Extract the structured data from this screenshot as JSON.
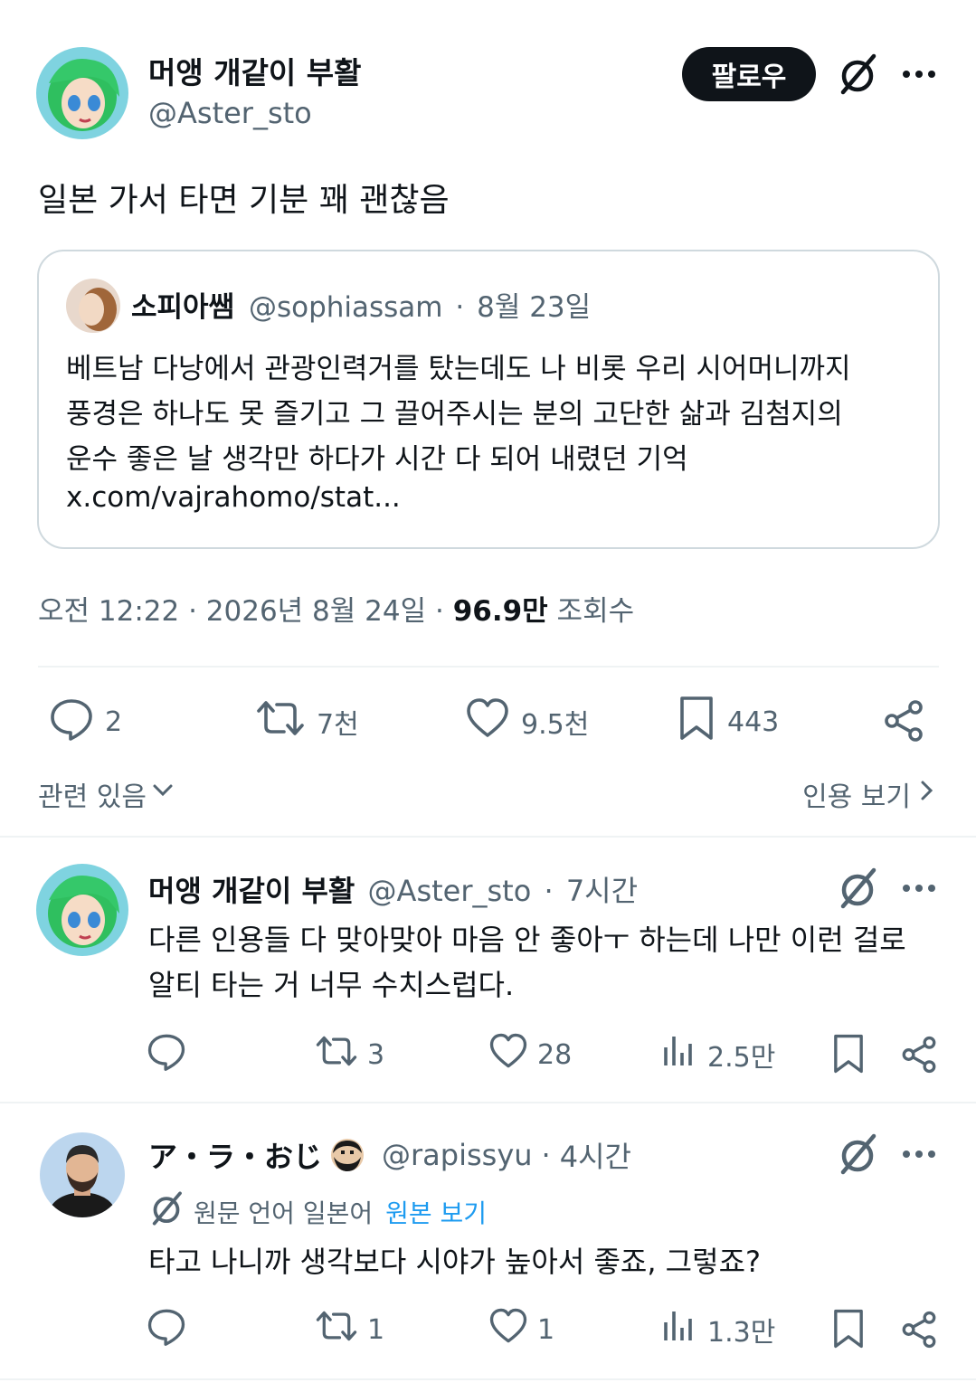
{
  "main_post": {
    "author_name": "머앵 개같이 부활",
    "author_handle": "@Aster_sto",
    "follow_label": "팔로우",
    "text": "일본 가서 타면 기분 꽤 괜찮음",
    "quote": {
      "author_name": "소피아쌤",
      "author_handle": "@sophiassam",
      "separator": "·",
      "date": "8월 23일",
      "line1": "베트남 다낭에서 관광인력거를 탔는데도 나 비롯 우리 시어머니까지",
      "line2": "풍경은 하나도 못 즐기고 그 끌어주시는 분의 고단한 삶과 김첨지의",
      "line3": "운수 좋은 날 생각만 하다가 시간 다 되어 내렸던 기억",
      "link": "x.com/vajrahomo/stat..."
    },
    "meta_time": "오전 12:22 · 2026년 8월 24일 · ",
    "views_count": "96.9만",
    "views_label": " 조회수",
    "stats": {
      "replies": "2",
      "reposts": "7천",
      "likes": "9.5천",
      "bookmarks": "443"
    },
    "related_label": "관련 있음",
    "quotes_label": "인용 보기"
  },
  "replies": [
    {
      "author_name": "머앵 개같이 부활",
      "author_handle": "@Aster_sto",
      "separator": "·",
      "time": "7시간",
      "line1": "다른 인용들 다 맞아맞아 마음 안 좋아ㅜ 하는데 나만 이런 걸로",
      "line2": "알티 타는 거 너무 수치스럽다.",
      "stats": {
        "replies": "",
        "reposts": "3",
        "likes": "28",
        "views": "2.5만"
      }
    },
    {
      "author_name": "ア・ラ・おじ",
      "author_handle": "@rapissyu",
      "separator": "·",
      "time": "4시간",
      "translation_note": "원문 언어 일본어",
      "translation_link": "원본 보기",
      "line1": "타고 나니까 생각보다 시야가 높아서 좋죠, 그렇죠?",
      "stats": {
        "replies": "",
        "reposts": "1",
        "likes": "1",
        "views": "1.3만"
      }
    }
  ],
  "colors": {
    "text": "#0f1419",
    "secondary": "#536471",
    "link": "#1d9bf0",
    "border": "#cfd9de",
    "divider": "#eff3f4"
  }
}
